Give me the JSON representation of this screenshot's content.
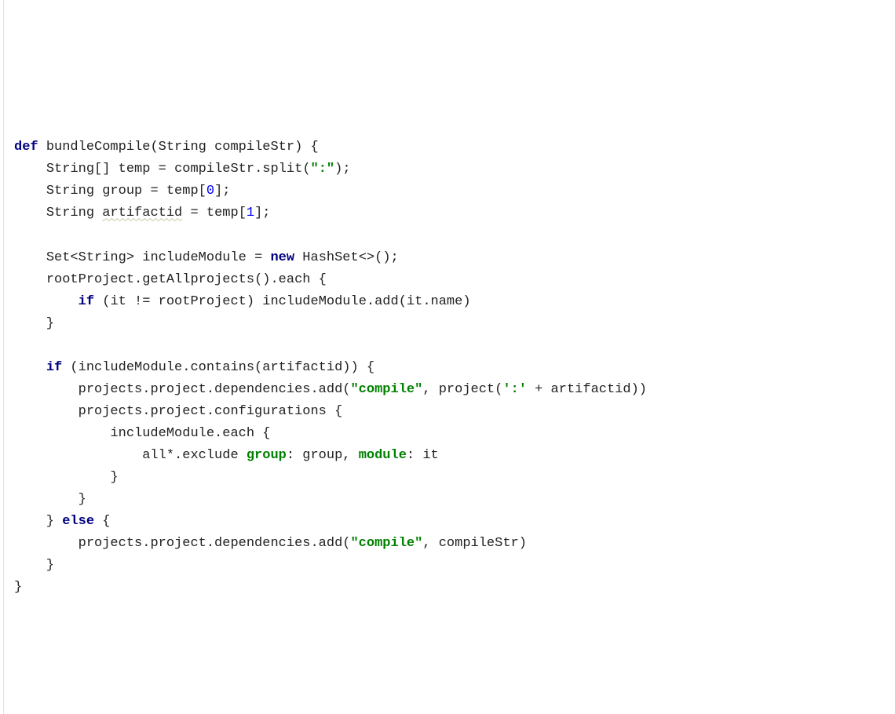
{
  "code": {
    "kw_def": "def",
    "fn_name": "bundleCompile",
    "param_type": "String",
    "param_name": "compileStr",
    "l2_type": "String[]",
    "l2_var": "temp",
    "l2_rhs_obj": "compileStr",
    "l2_method": "split",
    "l2_arg": "\":\"",
    "l3_type": "String",
    "l3_var": "group",
    "l3_rhs": "temp",
    "l3_idx": "0",
    "l4_type": "String",
    "l4_var": "artifactid",
    "l4_rhs": "temp",
    "l4_idx": "1",
    "l6_type_outer": "Set",
    "l6_type_inner": "String",
    "l6_var": "includeModule",
    "kw_new": "new",
    "l6_ctor": "HashSet<>",
    "l7_obj": "rootProject",
    "l7_m1": "getAllprojects",
    "l7_m2": "each",
    "kw_if": "if",
    "l8_cond_lhs": "it",
    "l8_cond_rhs": "rootProject",
    "l8_call_obj": "includeModule",
    "l8_call_m": "add",
    "l8_call_arg": "it.name",
    "l11_cond": "includeModule.contains(artifactid)",
    "l12_chain": "projects.project.dependencies.add",
    "l12_arg1": "\"compile\"",
    "l12_arg2a": "project(",
    "l12_arg2b": "':'",
    "l12_arg2c": " + artifactid))",
    "l13_chain": "projects.project.configurations",
    "l14_obj": "includeModule",
    "l14_m": "each",
    "l15_lhs": "all*.exclude ",
    "l15_k1": "group",
    "l15_v1": " group, ",
    "l15_k2": "module",
    "l15_v2": " it",
    "kw_else": "else",
    "l19_chain": "projects.project.dependencies.add",
    "l19_arg1": "\"compile\"",
    "l19_arg2": "compileStr"
  }
}
